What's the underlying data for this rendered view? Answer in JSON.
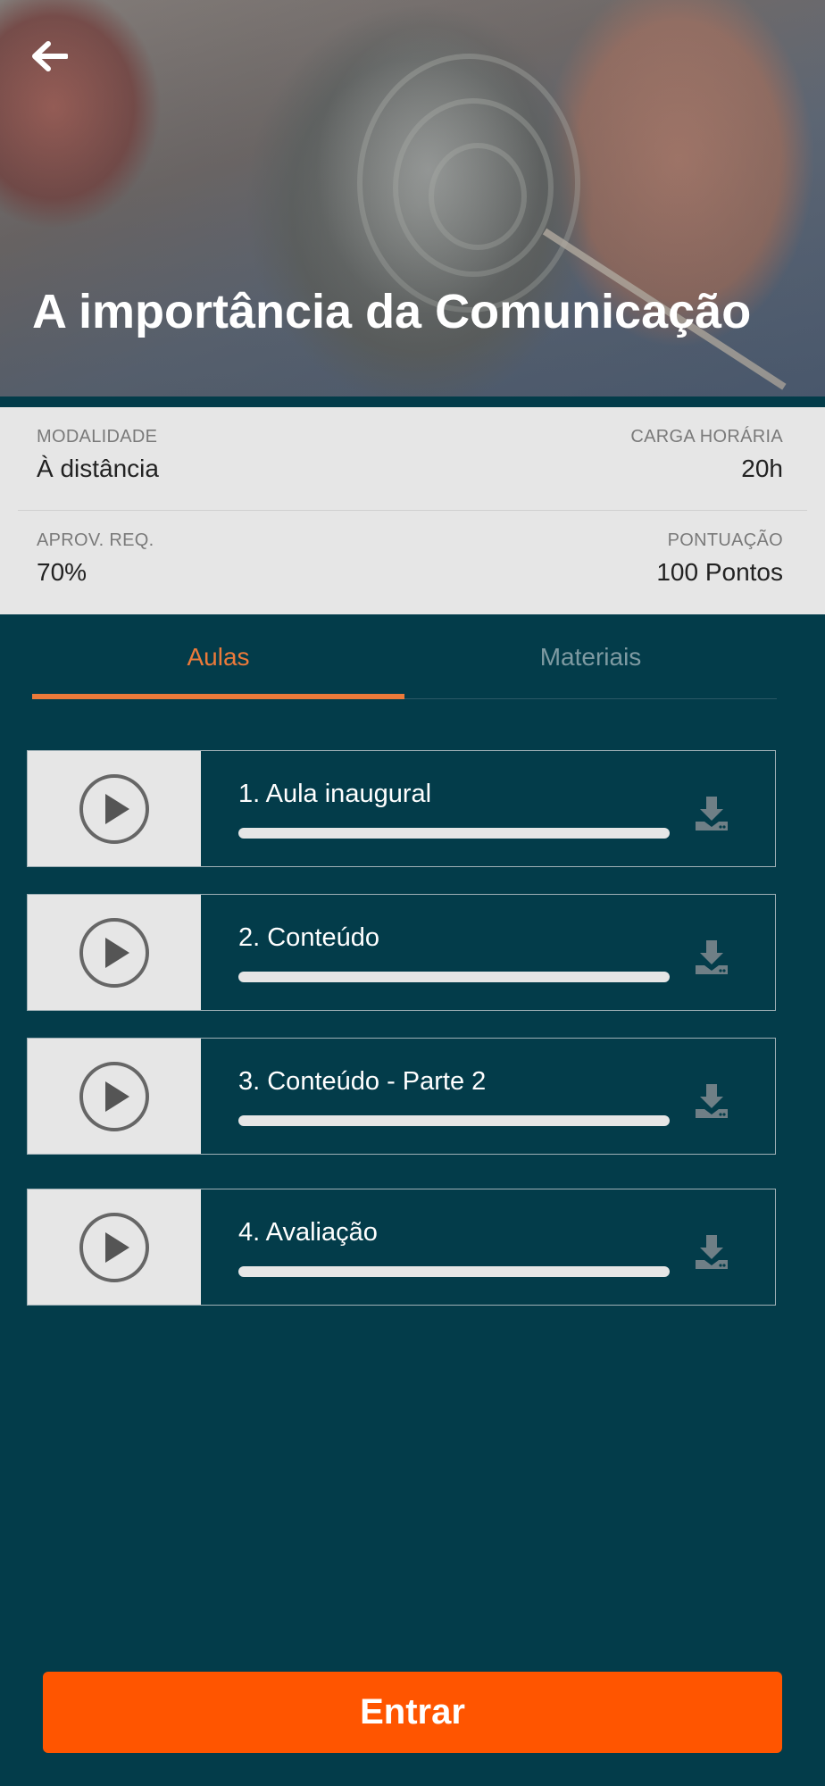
{
  "header": {
    "title": "A importância da Comunicação",
    "back_icon": "arrow-left-icon"
  },
  "info": {
    "modality_label": "MODALIDADE",
    "modality_value": "À distância",
    "workload_label": "CARGA HORÁRIA",
    "workload_value": "20h",
    "approval_label": "APROV. REQ.",
    "approval_value": "70%",
    "score_label": "PONTUAÇÃO",
    "score_value": "100 Pontos"
  },
  "tabs": [
    {
      "label": "Aulas",
      "active": true
    },
    {
      "label": "Materiais",
      "active": false
    }
  ],
  "lessons": [
    {
      "title": "1. Aula inaugural",
      "progress": 0,
      "icon": "play-icon",
      "action_icon": "download-icon"
    },
    {
      "title": "2. Conteúdo",
      "progress": 0,
      "icon": "play-icon",
      "action_icon": "download-icon"
    },
    {
      "title": "3. Conteúdo - Parte 2",
      "progress": 0,
      "icon": "play-icon",
      "action_icon": "download-icon"
    },
    {
      "title": "4. Avaliação",
      "progress": 0,
      "icon": "play-icon",
      "action_icon": "download-icon"
    }
  ],
  "footer": {
    "enter_label": "Entrar"
  },
  "colors": {
    "background": "#033c4a",
    "accent": "#ec7a3a",
    "button": "#ff5500",
    "panel": "#e6e6e6"
  }
}
